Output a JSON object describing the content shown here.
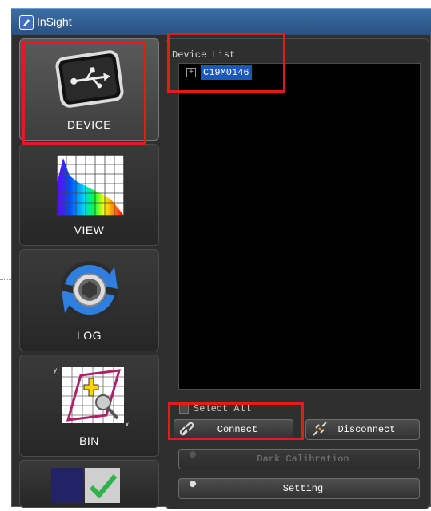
{
  "window": {
    "title": "InSight"
  },
  "sidebar": {
    "items": [
      {
        "label": "DEVICE"
      },
      {
        "label": "VIEW"
      },
      {
        "label": "LOG"
      },
      {
        "label": "BIN"
      }
    ]
  },
  "main": {
    "device_list_label": "Device List",
    "devices": [
      {
        "name": "C19M0146",
        "expander": "+"
      }
    ],
    "select_all_label": "Select All",
    "buttons": {
      "connect": "Connect",
      "disconnect": "Disconnect",
      "dark_calibration": "Dark Calibration",
      "setting": "Setting"
    }
  },
  "colors": {
    "highlight": "#e21b1b",
    "selection": "#1c57ba",
    "titlebar": "#2a5180"
  }
}
